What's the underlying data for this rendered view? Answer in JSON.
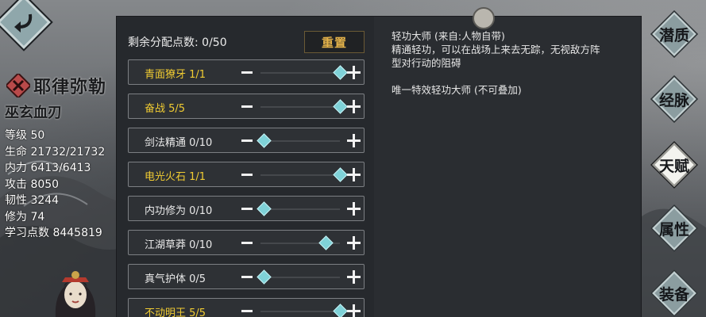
{
  "character": {
    "name": "耶律弥勒",
    "title": "巫玄血刃",
    "stats": [
      "等级 50",
      "生命 21732/21732",
      "内力 6413/6413",
      "攻击 8050",
      "韧性 3244",
      "修为 74",
      "学习点数 8445819"
    ]
  },
  "panel": {
    "points_label": "剩余分配点数: 0/50",
    "reset_label": "重置",
    "talents": [
      {
        "name": "青面獠牙 1/1",
        "level": 1,
        "max": 1,
        "maxed": true
      },
      {
        "name": "奋战 5/5",
        "level": 5,
        "max": 5,
        "maxed": true
      },
      {
        "name": "剑法精通 0/10",
        "level": 0,
        "max": 10,
        "maxed": false
      },
      {
        "name": "电光火石 1/1",
        "level": 1,
        "max": 1,
        "maxed": true
      },
      {
        "name": "内功修为 0/10",
        "level": 0,
        "max": 10,
        "maxed": false
      },
      {
        "name": "江湖草莽 0/10",
        "level": 0,
        "max": 10,
        "maxed": false
      },
      {
        "name": "真气护体 0/5",
        "level": 0,
        "max": 5,
        "maxed": false
      },
      {
        "name": "不动明王 5/5",
        "level": 5,
        "max": 5,
        "maxed": true
      }
    ],
    "description": {
      "line1": "轻功大师 (来自:人物自带)",
      "line2": "精通轻功，可以在战场上来去无踪，无视敌方阵",
      "line3": "型对行动的阻碍",
      "line4": "唯一特效轻功大师 (不可叠加)"
    }
  },
  "nav": {
    "items": [
      {
        "label": "潜质",
        "active": false
      },
      {
        "label": "经脉",
        "active": false
      },
      {
        "label": "天赋",
        "active": true
      },
      {
        "label": "属性",
        "active": false
      },
      {
        "label": "装备",
        "active": false
      }
    ]
  },
  "colors": {
    "maxed_text": "#f1cc32",
    "knob": "#7fd2d8",
    "reset_text": "#e3b24a"
  }
}
